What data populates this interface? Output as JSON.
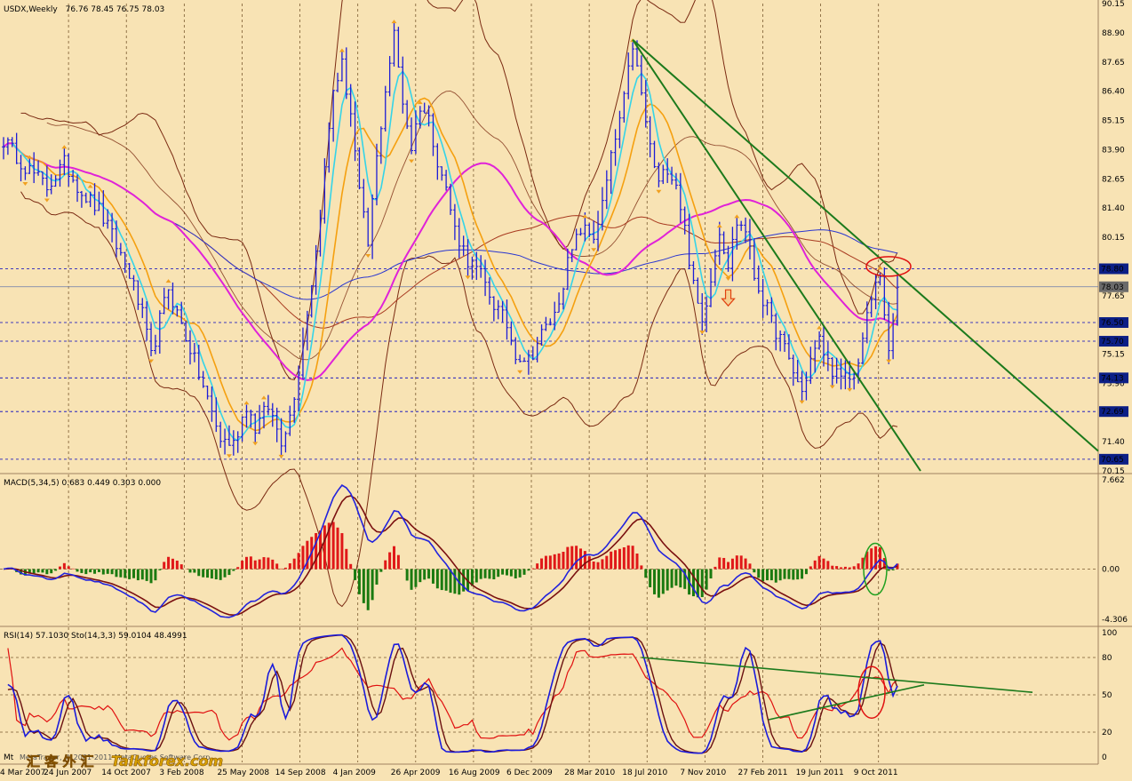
{
  "colors": {
    "background": "#f8e3b4",
    "price_bar": "#1d1dd6",
    "ma_cyan": "#35d4e8",
    "ma_orange": "#f5a010",
    "ma_magenta": "#e022d8",
    "ma_blue": "#2a36d0",
    "envelope": "#7a2a12",
    "trendline": "#1c7a1c",
    "fractal": "#f0a020",
    "macd_pos": "#e01818",
    "macd_neg": "#1a7a10",
    "macd_line": "#2222dd",
    "signal_line": "#7a1010",
    "rsi_line": "#e01010",
    "stoch_k": "#1a1adb",
    "stoch_d": "#6a1010",
    "highlight_red": "#e01010",
    "highlight_green": "#20a020",
    "current_price_tag": "#6a6a6a",
    "level_tag": "#0c1f86"
  },
  "header": {
    "symbol": "USDX,Weekly",
    "ohlc": "76.76 78.45 76.75 78.03"
  },
  "macd_header": "MACD(5,34,5) 0.683 0.449 0.303 0.000",
  "rsi_header": "RSI(14) 57.1030  Sto(14,3,3) 59.0104 48.4991",
  "watermark": {
    "text_left": "Mt",
    "copyright": "MetaTrader, © 2001-2011 MetaQuotes Software Corp.",
    "site": "Talkforex.com",
    "chinese": "汇 客 外 汇"
  },
  "chart_data": [
    {
      "type": "candlestick",
      "panel": "price",
      "title": "USDX,Weekly",
      "timeframe": "Weekly",
      "ylim": [
        70.15,
        90.15
      ],
      "y_ticks": [
        90.15,
        88.9,
        87.65,
        86.4,
        85.15,
        83.9,
        82.65,
        81.4,
        80.15,
        78.9,
        77.65,
        76.4,
        75.15,
        73.9,
        72.65,
        71.4,
        70.15
      ],
      "x_ticks": [
        "4 Mar 2007",
        "24 Jun 2007",
        "14 Oct 2007",
        "3 Feb 2008",
        "25 May 2008",
        "14 Sep 2008",
        "4 Jan 2009",
        "26 Apr 2009",
        "16 Aug 2009",
        "6 Dec 2009",
        "28 Mar 2010",
        "18 Jul 2010",
        "7 Nov 2010",
        "27 Feb 2011",
        "19 Jun 2011",
        "9 Oct 2011"
      ],
      "current_price": 78.03,
      "levels": [
        78.8,
        76.5,
        75.7,
        74.13,
        72.69,
        70.65
      ],
      "price_path": [
        [
          0,
          84.3
        ],
        [
          5,
          83.2
        ],
        [
          10,
          82.3
        ],
        [
          14,
          83.3
        ],
        [
          18,
          82.1
        ],
        [
          22,
          81.3
        ],
        [
          25,
          80.2
        ],
        [
          29,
          78.6
        ],
        [
          32,
          76.8
        ],
        [
          34,
          75.0
        ],
        [
          36,
          76.6
        ],
        [
          38,
          78.0
        ],
        [
          40,
          76.9
        ],
        [
          43,
          75.4
        ],
        [
          47,
          73.2
        ],
        [
          50,
          71.5
        ],
        [
          53,
          71.3
        ],
        [
          56,
          73.0
        ],
        [
          58,
          72.0
        ],
        [
          61,
          72.9
        ],
        [
          64,
          71.5
        ],
        [
          66,
          72.5
        ],
        [
          68,
          74.5
        ],
        [
          70,
          77.0
        ],
        [
          72,
          79.5
        ],
        [
          74,
          83.0
        ],
        [
          76,
          86.5
        ],
        [
          78,
          87.5
        ],
        [
          80,
          85.5
        ],
        [
          82,
          82.0
        ],
        [
          84,
          79.8
        ],
        [
          86,
          83.5
        ],
        [
          88,
          86.5
        ],
        [
          90,
          88.8
        ],
        [
          92,
          86.0
        ],
        [
          94,
          84.0
        ],
        [
          96,
          85.8
        ],
        [
          98,
          85.2
        ],
        [
          100,
          83.5
        ],
        [
          102,
          82.2
        ],
        [
          104,
          80.5
        ],
        [
          107,
          79.2
        ],
        [
          110,
          78.5
        ],
        [
          113,
          77.3
        ],
        [
          116,
          76.4
        ],
        [
          118,
          75.2
        ],
        [
          121,
          74.9
        ],
        [
          124,
          76.0
        ],
        [
          127,
          76.8
        ],
        [
          130,
          79.0
        ],
        [
          133,
          80.5
        ],
        [
          136,
          80.2
        ],
        [
          138,
          81.5
        ],
        [
          140,
          83.5
        ],
        [
          143,
          86.0
        ],
        [
          145,
          88.4
        ],
        [
          147,
          86.2
        ],
        [
          149,
          84.0
        ],
        [
          151,
          82.4
        ],
        [
          153,
          83.2
        ],
        [
          155,
          82.5
        ],
        [
          157,
          80.5
        ],
        [
          159,
          78.0
        ],
        [
          161,
          76.5
        ],
        [
          163,
          78.5
        ],
        [
          165,
          80.5
        ],
        [
          167,
          79.0
        ],
        [
          169,
          80.8
        ],
        [
          171,
          80.5
        ],
        [
          173,
          78.5
        ],
        [
          175,
          77.5
        ],
        [
          177,
          76.5
        ],
        [
          179,
          75.8
        ],
        [
          182,
          74.4
        ],
        [
          184,
          73.5
        ],
        [
          186,
          74.9
        ],
        [
          188,
          75.7
        ],
        [
          190,
          74.8
        ],
        [
          193,
          74.0
        ],
        [
          196,
          74.2
        ],
        [
          198,
          75.8
        ],
        [
          200,
          77.5
        ],
        [
          202,
          78.6
        ],
        [
          203,
          77.0
        ],
        [
          204,
          75.0
        ],
        [
          205,
          76.5
        ],
        [
          206,
          78.0
        ]
      ]
    },
    {
      "type": "bar_line",
      "panel": "macd",
      "title": "MACD(5,34,5)",
      "values": [
        0.683,
        0.449,
        0.303,
        0.0
      ],
      "ylim": [
        -4.306,
        7.662
      ],
      "y_ticks": [
        7.662,
        0.0,
        -4.306
      ],
      "x_ticks": [
        "4 Mar 2007",
        "24 Jun 2007",
        "14 Oct 2007",
        "3 Feb 2008",
        "25 May 2008",
        "14 Sep 2008",
        "4 Jan 2009",
        "26 Apr 2009",
        "16 Aug 2009",
        "6 Dec 2009",
        "28 Mar 2010",
        "18 Jul 2010",
        "7 Nov 2010",
        "27 Feb 2011",
        "19 Jun 2011",
        "9 Oct 2011"
      ]
    },
    {
      "type": "line",
      "panel": "oscillators",
      "title": "RSI(14) Sto(14,3,3)",
      "values": {
        "rsi": 57.103,
        "stoch_main": 59.0104,
        "stoch_signal": 48.4991
      },
      "ylim": [
        0,
        100
      ],
      "y_ticks": [
        100,
        80,
        50,
        20,
        0
      ],
      "x_ticks": [
        "4 Mar 2007",
        "24 Jun 2007",
        "14 Oct 2007",
        "3 Feb 2008",
        "25 May 2008",
        "14 Sep 2008",
        "4 Jan 2009",
        "26 Apr 2009",
        "16 Aug 2009",
        "6 Dec 2009",
        "28 Mar 2010",
        "18 Jul 2010",
        "7 Nov 2010",
        "27 Feb 2011",
        "19 Jun 2011",
        "9 Oct 2011"
      ]
    }
  ]
}
